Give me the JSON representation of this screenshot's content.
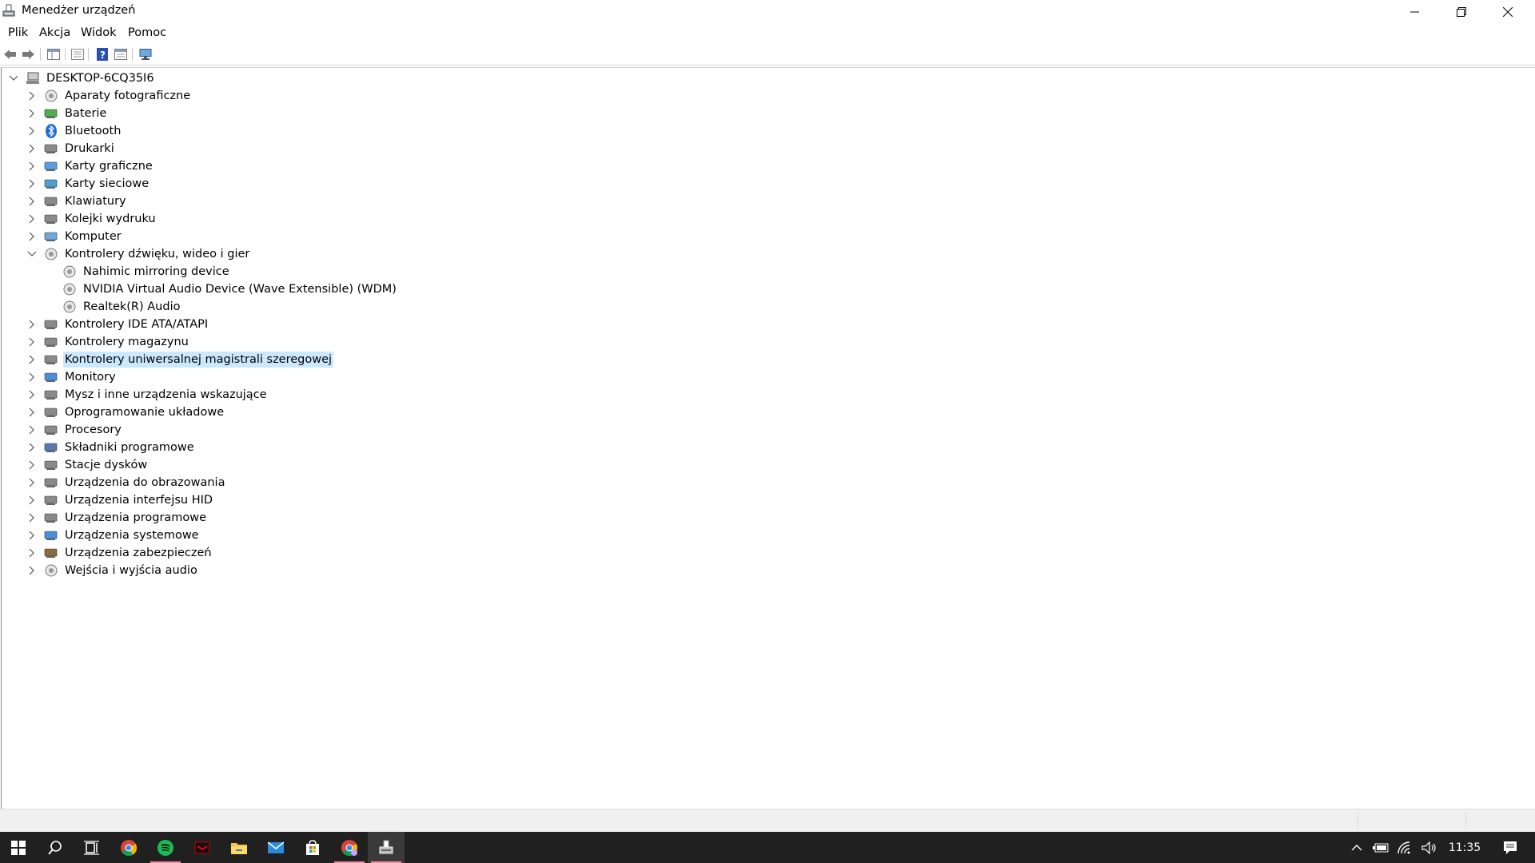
{
  "window": {
    "title": "Menedżer urządzeń"
  },
  "menu": [
    "Plik",
    "Akcja",
    "Widok",
    "Pomoc"
  ],
  "toolbar": {
    "buttons": [
      "back-icon",
      "forward-icon",
      "show-hide-console-tree-icon",
      "properties-icon",
      "help-icon",
      "export-list-icon",
      "scan-hardware-icon"
    ]
  },
  "tree": {
    "root": "DESKTOP-6CQ35I6",
    "items": [
      {
        "label": "Aparaty fotograficzne",
        "icon": "camera-icon",
        "expanded": false
      },
      {
        "label": "Baterie",
        "icon": "battery-icon",
        "expanded": false
      },
      {
        "label": "Bluetooth",
        "icon": "bluetooth-icon",
        "expanded": false
      },
      {
        "label": "Drukarki",
        "icon": "printer-icon",
        "expanded": false
      },
      {
        "label": "Karty graficzne",
        "icon": "display-adapter-icon",
        "expanded": false
      },
      {
        "label": "Karty sieciowe",
        "icon": "network-adapter-icon",
        "expanded": false
      },
      {
        "label": "Klawiatury",
        "icon": "keyboard-icon",
        "expanded": false
      },
      {
        "label": "Kolejki wydruku",
        "icon": "print-queue-icon",
        "expanded": false
      },
      {
        "label": "Komputer",
        "icon": "computer-icon",
        "expanded": false
      },
      {
        "label": "Kontrolery dźwięku, wideo i gier",
        "icon": "speaker-icon",
        "expanded": true
      },
      {
        "label": "Kontrolery IDE ATA/ATAPI",
        "icon": "ide-controller-icon",
        "expanded": false
      },
      {
        "label": "Kontrolery magazynu",
        "icon": "storage-controller-icon",
        "expanded": false
      },
      {
        "label": "Kontrolery uniwersalnej magistrali szeregowej",
        "icon": "usb-icon",
        "expanded": false,
        "selected": true
      },
      {
        "label": "Monitory",
        "icon": "monitor-icon",
        "expanded": false
      },
      {
        "label": "Mysz i inne urządzenia wskazujące",
        "icon": "mouse-icon",
        "expanded": false
      },
      {
        "label": "Oprogramowanie układowe",
        "icon": "firmware-icon",
        "expanded": false
      },
      {
        "label": "Procesory",
        "icon": "processor-icon",
        "expanded": false
      },
      {
        "label": "Składniki programowe",
        "icon": "software-component-icon",
        "expanded": false
      },
      {
        "label": "Stacje dysków",
        "icon": "disk-drive-icon",
        "expanded": false
      },
      {
        "label": "Urządzenia do obrazowania",
        "icon": "imaging-device-icon",
        "expanded": false
      },
      {
        "label": "Urządzenia interfejsu HID",
        "icon": "hid-icon",
        "expanded": false
      },
      {
        "label": "Urządzenia programowe",
        "icon": "software-device-icon",
        "expanded": false
      },
      {
        "label": "Urządzenia systemowe",
        "icon": "system-device-icon",
        "expanded": false
      },
      {
        "label": "Urządzenia zabezpieczeń",
        "icon": "security-device-icon",
        "expanded": false
      },
      {
        "label": "Wejścia i wyjścia audio",
        "icon": "audio-io-icon",
        "expanded": false
      }
    ],
    "children_of_sound": [
      "Nahimic mirroring device",
      "NVIDIA Virtual Audio Device (Wave Extensible) (WDM)",
      "Realtek(R) Audio"
    ]
  },
  "taskbar": {
    "apps": [
      "start-icon",
      "search-icon",
      "task-view-icon",
      "chrome-icon",
      "spotify-icon",
      "game-app-icon",
      "file-explorer-icon",
      "mail-icon",
      "store-icon",
      "chrome-profile-icon",
      "device-manager-icon"
    ],
    "clock": "11:35"
  },
  "colors": {
    "selection": "#cce8ff",
    "taskbar": "#202020",
    "accent_underline": "#f08aa0"
  }
}
